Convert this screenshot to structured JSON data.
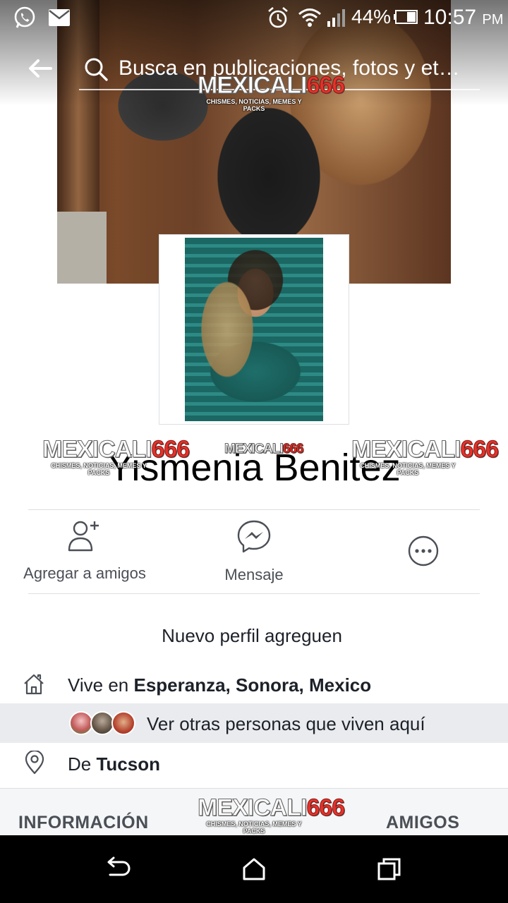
{
  "status_bar": {
    "battery_percent": "44%",
    "time": "10:57",
    "time_suffix": "PM",
    "icons": [
      "whatsapp-icon",
      "mail-icon",
      "alarm-icon",
      "wifi-icon",
      "signal-icon",
      "battery-icon"
    ]
  },
  "search": {
    "placeholder": "Busca en publicaciones, fotos y et…"
  },
  "watermark": {
    "brand": "MEXICALI",
    "number": "666",
    "tagline": "CHISMES, NOTICIAS, MEMES Y PACKS"
  },
  "profile": {
    "name": "Yismenia Benitez"
  },
  "actions": {
    "add_friend": "Agregar a amigos",
    "message": "Mensaje"
  },
  "intro": {
    "bio": "Nuevo perfil agreguen",
    "lives_prefix": "Vive en ",
    "lives_place": "Esperanza, Sonora, Mexico",
    "see_others": "Ver otras personas que viven aquí",
    "from_prefix": "De ",
    "from_place": "Tucson"
  },
  "sections": {
    "info": "INFORMACIÓN",
    "friends": "AMIGOS"
  }
}
